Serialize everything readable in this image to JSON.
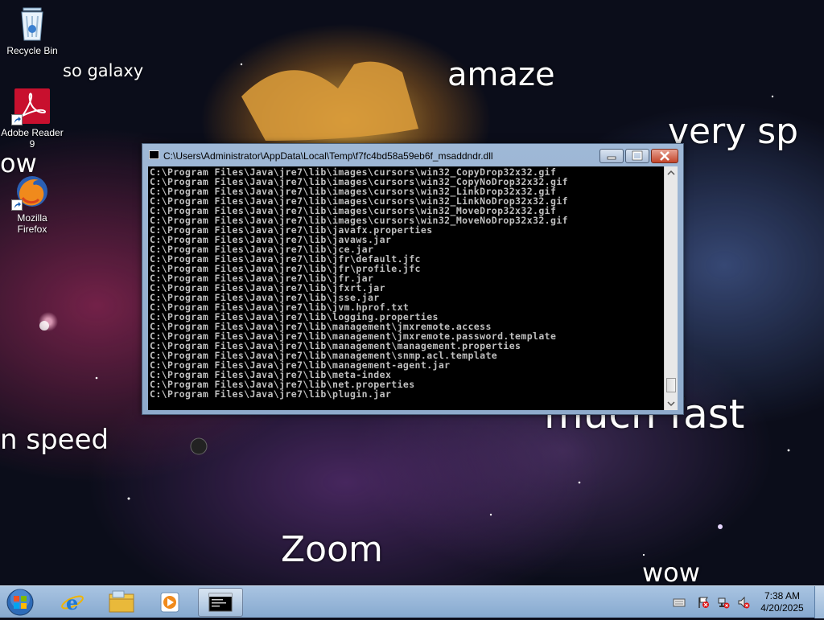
{
  "desktop": {
    "meme_texts": {
      "so_galaxy": "so galaxy",
      "amaze": "amaze",
      "very_sp": "very sp",
      "ow": "ow",
      "n_speed": "n speed",
      "much_fast": "much fast",
      "zoom": "Zoom",
      "wow": "wow"
    },
    "icons": [
      {
        "label": "Recycle Bin",
        "icon": "recycle-bin-icon"
      },
      {
        "label": "Adobe Reader 9",
        "icon": "adobe-reader-icon"
      },
      {
        "label": "Mozilla Firefox",
        "icon": "firefox-icon"
      }
    ]
  },
  "console_window": {
    "title": "C:\\Users\\Administrator\\AppData\\Local\\Temp\\f7fc4bd58a59eb6f_msaddndr.dll",
    "lines": [
      "C:\\Program Files\\Java\\jre7\\lib\\images\\cursors\\win32_CopyDrop32x32.gif",
      "C:\\Program Files\\Java\\jre7\\lib\\images\\cursors\\win32_CopyNoDrop32x32.gif",
      "C:\\Program Files\\Java\\jre7\\lib\\images\\cursors\\win32_LinkDrop32x32.gif",
      "C:\\Program Files\\Java\\jre7\\lib\\images\\cursors\\win32_LinkNoDrop32x32.gif",
      "C:\\Program Files\\Java\\jre7\\lib\\images\\cursors\\win32_MoveDrop32x32.gif",
      "C:\\Program Files\\Java\\jre7\\lib\\images\\cursors\\win32_MoveNoDrop32x32.gif",
      "C:\\Program Files\\Java\\jre7\\lib\\javafx.properties",
      "C:\\Program Files\\Java\\jre7\\lib\\javaws.jar",
      "C:\\Program Files\\Java\\jre7\\lib\\jce.jar",
      "C:\\Program Files\\Java\\jre7\\lib\\jfr\\default.jfc",
      "C:\\Program Files\\Java\\jre7\\lib\\jfr\\profile.jfc",
      "C:\\Program Files\\Java\\jre7\\lib\\jfr.jar",
      "C:\\Program Files\\Java\\jre7\\lib\\jfxrt.jar",
      "C:\\Program Files\\Java\\jre7\\lib\\jsse.jar",
      "C:\\Program Files\\Java\\jre7\\lib\\jvm.hprof.txt",
      "C:\\Program Files\\Java\\jre7\\lib\\logging.properties",
      "C:\\Program Files\\Java\\jre7\\lib\\management\\jmxremote.access",
      "C:\\Program Files\\Java\\jre7\\lib\\management\\jmxremote.password.template",
      "C:\\Program Files\\Java\\jre7\\lib\\management\\management.properties",
      "C:\\Program Files\\Java\\jre7\\lib\\management\\snmp.acl.template",
      "C:\\Program Files\\Java\\jre7\\lib\\management-agent.jar",
      "C:\\Program Files\\Java\\jre7\\lib\\meta-index",
      "C:\\Program Files\\Java\\jre7\\lib\\net.properties",
      "C:\\Program Files\\Java\\jre7\\lib\\plugin.jar"
    ],
    "scroll_position": 0.95
  },
  "taskbar": {
    "pinned": [
      "start-orb-icon",
      "internet-explorer-icon",
      "file-explorer-icon",
      "media-player-icon",
      "console-window-icon"
    ],
    "tray_icons": [
      "keyboard-icon",
      "action-center-flag-icon",
      "network-icon",
      "volume-muted-icon"
    ],
    "time": "7:38 AM",
    "date": "4/20/2025"
  },
  "colors": {
    "taskbar": "#93b3d6",
    "console_bg": "#000000",
    "console_text": "#c0c0c0",
    "close_button": "#c9482c"
  }
}
